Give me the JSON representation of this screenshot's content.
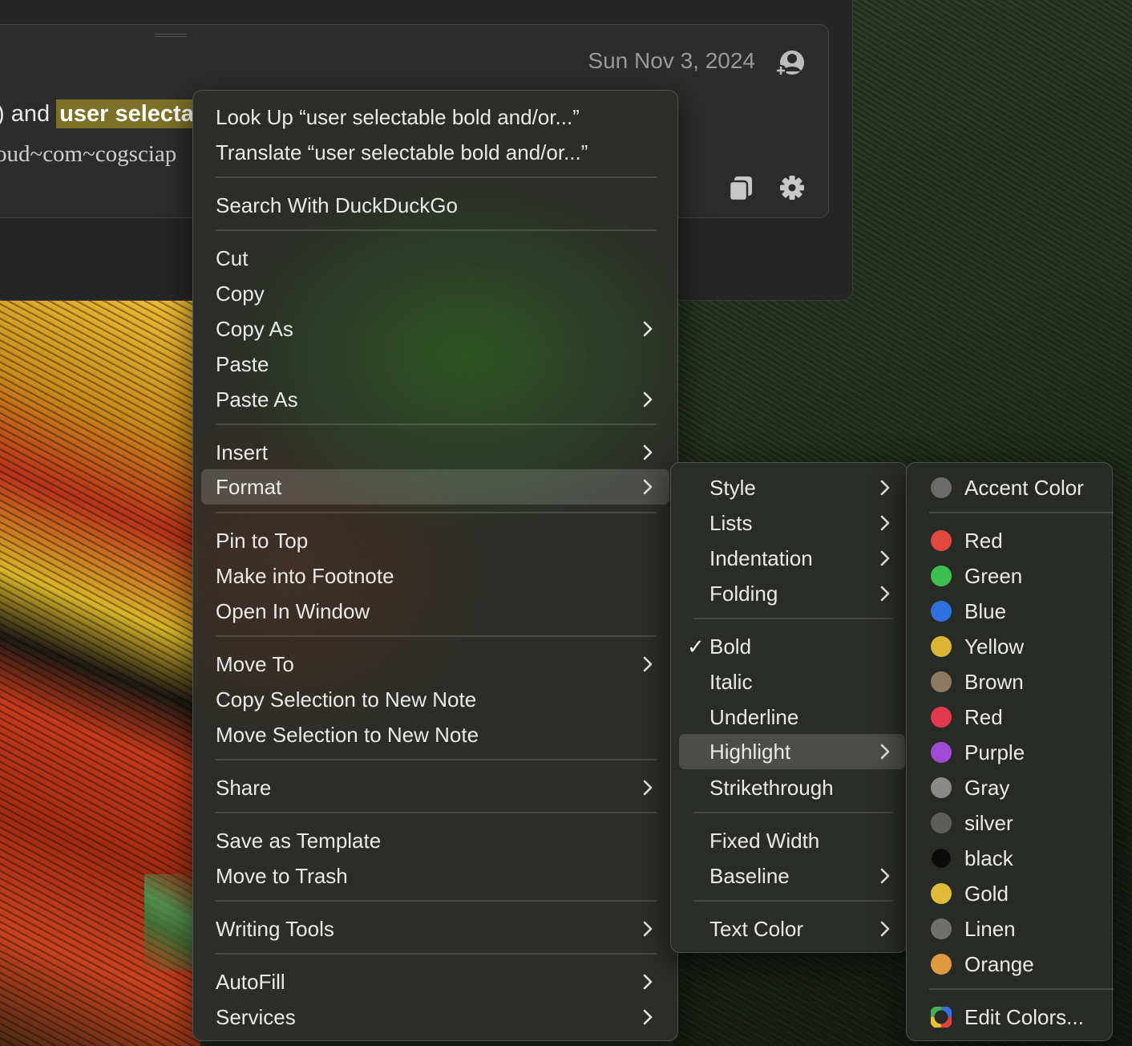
{
  "note": {
    "date": "Sun Nov 3, 2024",
    "text_line1_pre": ") and ",
    "text_line1_highlight": "user selecta",
    "text_line2": "oud~com~cogsciap"
  },
  "context_menu": {
    "look_up": "Look Up “user selectable bold and/or...”",
    "translate": "Translate “user selectable bold and/or...”",
    "search": "Search With DuckDuckGo",
    "cut": "Cut",
    "copy": "Copy",
    "copy_as": "Copy As",
    "paste": "Paste",
    "paste_as": "Paste As",
    "insert": "Insert",
    "format": "Format",
    "pin_to_top": "Pin to Top",
    "make_footnote": "Make into Footnote",
    "open_in_window": "Open In Window",
    "move_to": "Move To",
    "copy_selection": "Copy Selection to New Note",
    "move_selection": "Move Selection to New Note",
    "share": "Share",
    "save_template": "Save as Template",
    "move_trash": "Move to Trash",
    "writing_tools": "Writing Tools",
    "autofill": "AutoFill",
    "services": "Services"
  },
  "format_menu": {
    "style": "Style",
    "lists": "Lists",
    "indentation": "Indentation",
    "folding": "Folding",
    "checkmark": "✓",
    "bold": "Bold",
    "italic": "Italic",
    "underline": "Underline",
    "highlight": "Highlight",
    "strikethrough": "Strikethrough",
    "fixed_width": "Fixed Width",
    "baseline": "Baseline",
    "text_color": "Text Color"
  },
  "highlight_menu": {
    "accent": {
      "label": "Accent Color",
      "color": "#6b6b6b"
    },
    "colors": [
      {
        "label": "Red",
        "color": "#e0483f"
      },
      {
        "label": "Green",
        "color": "#3fbf4f"
      },
      {
        "label": "Blue",
        "color": "#2f6fe0"
      },
      {
        "label": "Yellow",
        "color": "#dcb434"
      },
      {
        "label": "Brown",
        "color": "#8c7a62"
      },
      {
        "label": "Red",
        "color": "#e0394f"
      },
      {
        "label": "Purple",
        "color": "#a04ad6"
      },
      {
        "label": "Gray",
        "color": "#8a8a8a"
      },
      {
        "label": "silver",
        "color": "#5d5d5a"
      },
      {
        "label": "black",
        "color": "#0c0c0c"
      },
      {
        "label": "Gold",
        "color": "#e0bc3a"
      },
      {
        "label": "Linen",
        "color": "#6f6f6f"
      },
      {
        "label": "Orange",
        "color": "#df9a3e"
      }
    ],
    "edit_colors": "Edit Colors..."
  }
}
